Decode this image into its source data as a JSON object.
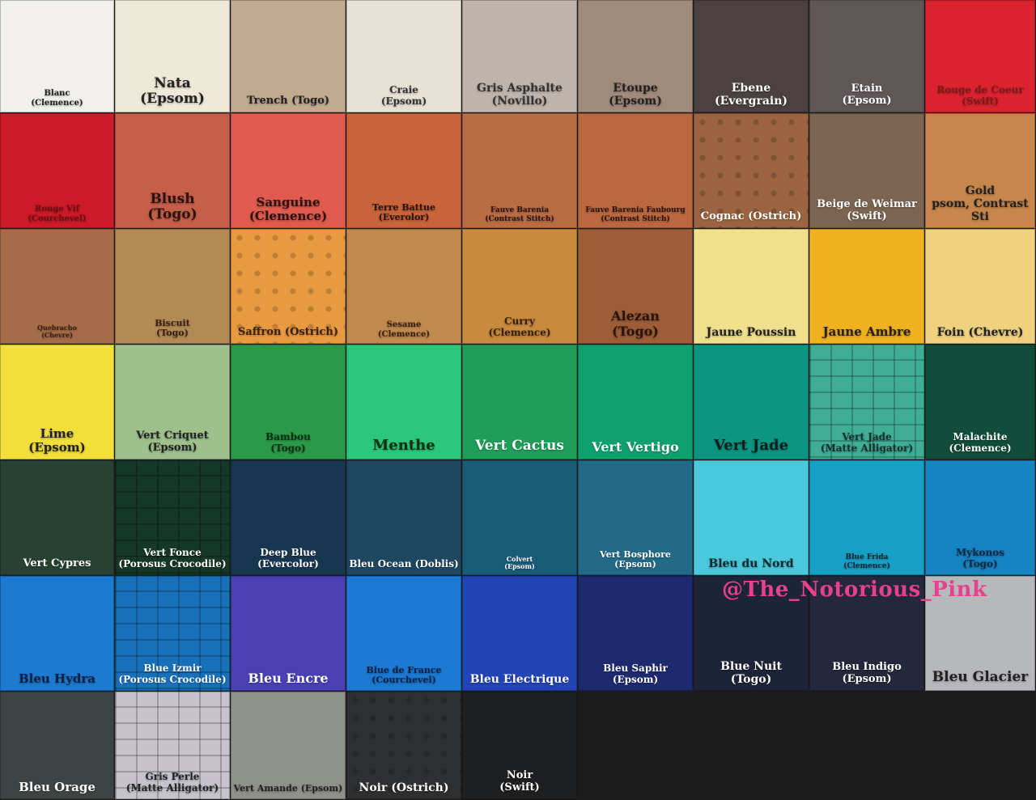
{
  "columns": 9,
  "watermark": "@The_Notorious_Pink",
  "swatches": [
    {
      "label": "Blanc\n(Clemence)",
      "bg": "#f1f0ec",
      "fg": "#222222",
      "size": 10
    },
    {
      "label": "Nata\n(Epsom)",
      "bg": "#efe9d9",
      "fg": "#222222",
      "size": 17
    },
    {
      "label": "Trench (Togo)",
      "bg": "#c1aa90",
      "fg": "#222222",
      "size": 13
    },
    {
      "label": "Craie\n(Epsom)",
      "bg": "#e8e2d6",
      "fg": "#333333",
      "size": 12
    },
    {
      "label": "Gris Asphalte\n(Novillo)",
      "bg": "#bfb5ad",
      "fg": "#333333",
      "size": 14
    },
    {
      "label": "Etoupe\n(Epsom)",
      "bg": "#a08a7c",
      "fg": "#222222",
      "size": 14
    },
    {
      "label": "Ebene\n(Evergrain)",
      "bg": "#4b4140",
      "fg": "#ffffff",
      "size": 14
    },
    {
      "label": "Etain\n(Epsom)",
      "bg": "#5f5757",
      "fg": "#ffffff",
      "size": 13
    },
    {
      "label": "Rouge de Coeur\n(Swift)",
      "bg": "#db2330",
      "fg": "#7a1a1a",
      "size": 12
    },
    {
      "label": "Rouge Vif\n(Courchevel)",
      "bg": "#cc1a2a",
      "fg": "#6a1010",
      "size": 10
    },
    {
      "label": "Blush\n(Togo)",
      "bg": "#c55f49",
      "fg": "#2a1410",
      "size": 17
    },
    {
      "label": "Sanguine\n(Clemence)",
      "bg": "#e05a4e",
      "fg": "#2a1410",
      "size": 15
    },
    {
      "label": "Terre Battue\n(Everolor)",
      "bg": "#c8633a",
      "fg": "#2a1410",
      "size": 11
    },
    {
      "label": "Fauve Barenia\n(Contrast Stitch)",
      "bg": "#b96d44",
      "fg": "#2a1410",
      "size": 9
    },
    {
      "label": "Fauve Barenia Faubourg\n(Contrast Stitch)",
      "bg": "#bb6840",
      "fg": "#2a1410",
      "size": 9
    },
    {
      "label": "Cognac (Ostrich)",
      "bg": "#9c6441",
      "fg": "#ffffff",
      "size": 13,
      "tex": "dots"
    },
    {
      "label": "Beige de Weimar\n(Swift)",
      "bg": "#7b6450",
      "fg": "#ffffff",
      "size": 13
    },
    {
      "label": "Gold\npsom, Contrast Sti",
      "bg": "#c7864b",
      "fg": "#222222",
      "size": 14
    },
    {
      "label": "Quebracho\n(Chevre)",
      "bg": "#a56c4a",
      "fg": "#3a2010",
      "size": 8
    },
    {
      "label": "Biscuit\n(Togo)",
      "bg": "#b38a55",
      "fg": "#3a2010",
      "size": 11
    },
    {
      "label": "Saffron (Ostrich)",
      "bg": "#e89a40",
      "fg": "#3a2010",
      "size": 13,
      "tex": "dots"
    },
    {
      "label": "Sesame\n(Clemence)",
      "bg": "#c08a4e",
      "fg": "#3a2010",
      "size": 10
    },
    {
      "label": "Curry\n(Clemence)",
      "bg": "#c88a3c",
      "fg": "#3a2010",
      "size": 12
    },
    {
      "label": "Alezan\n(Togo)",
      "bg": "#9c5d37",
      "fg": "#2a1410",
      "size": 16
    },
    {
      "label": "Jaune Poussin",
      "bg": "#f1e08b",
      "fg": "#222222",
      "size": 14
    },
    {
      "label": "Jaune Ambre",
      "bg": "#efb21e",
      "fg": "#2a2010",
      "size": 15
    },
    {
      "label": "Foin (Chevre)",
      "bg": "#f0d27e",
      "fg": "#222222",
      "size": 14
    },
    {
      "label": "Lime\n(Epsom)",
      "bg": "#f2df3a",
      "fg": "#222222",
      "size": 15
    },
    {
      "label": "Vert Criquet\n(Epsom)",
      "bg": "#9ec08c",
      "fg": "#222222",
      "size": 13
    },
    {
      "label": "Bambou\n(Togo)",
      "bg": "#2a9a4a",
      "fg": "#103010",
      "size": 12
    },
    {
      "label": "Menthe",
      "bg": "#2bc87c",
      "fg": "#103010",
      "size": 18
    },
    {
      "label": "Vert Cactus",
      "bg": "#1f9e5a",
      "fg": "#ffffff",
      "size": 17
    },
    {
      "label": "Vert Vertigo",
      "bg": "#0fa070",
      "fg": "#ffffff",
      "size": 16
    },
    {
      "label": "Vert Jade",
      "bg": "#0c9580",
      "fg": "#102020",
      "size": 18
    },
    {
      "label": "Vert Jade\n(Matte Alligator)",
      "bg": "#3fae94",
      "fg": "#1a3030",
      "size": 12,
      "tex": "croc"
    },
    {
      "label": "Malachite\n(Clemence)",
      "bg": "#124c3a",
      "fg": "#ffffff",
      "size": 12
    },
    {
      "label": "Vert Cypres",
      "bg": "#274232",
      "fg": "#ffffff",
      "size": 13
    },
    {
      "label": "Vert Fonce\n(Porosus Crocodile)",
      "bg": "#163828",
      "fg": "#ffffff",
      "size": 12,
      "tex": "croc"
    },
    {
      "label": "Deep Blue\n(Evercolor)",
      "bg": "#193650",
      "fg": "#ffffff",
      "size": 12
    },
    {
      "label": "Bleu Ocean (Doblis)",
      "bg": "#1f4860",
      "fg": "#ffffff",
      "size": 12
    },
    {
      "label": "Colvert\n(Epsom)",
      "bg": "#1a5c78",
      "fg": "#ffffff",
      "size": 8
    },
    {
      "label": "Vert Bosphore\n(Epsom)",
      "bg": "#226a88",
      "fg": "#ffffff",
      "size": 11
    },
    {
      "label": "Bleu du Nord",
      "bg": "#4ac8dc",
      "fg": "#102830",
      "size": 14
    },
    {
      "label": "Blue Frida\n(Clemence)",
      "bg": "#16a0c8",
      "fg": "#102830",
      "size": 9
    },
    {
      "label": "Mykonos\n(Togo)",
      "bg": "#1684c2",
      "fg": "#102840",
      "size": 12
    },
    {
      "label": "Bleu Hydra",
      "bg": "#1c7ad0",
      "fg": "#102040",
      "size": 15
    },
    {
      "label": "Blue Izmir\n(Porosus Crocodile)",
      "bg": "#1870b8",
      "fg": "#ffffff",
      "size": 12,
      "tex": "croc"
    },
    {
      "label": "Bleu Encre",
      "bg": "#4a40b4",
      "fg": "#ffffff",
      "size": 16
    },
    {
      "label": "Blue de France\n(Courchevel)",
      "bg": "#1c7ad4",
      "fg": "#102040",
      "size": 11
    },
    {
      "label": "Bleu Electrique",
      "bg": "#2244b4",
      "fg": "#ffffff",
      "size": 14
    },
    {
      "label": "Bleu Saphir\n(Epsom)",
      "bg": "#1d2a6e",
      "fg": "#ffffff",
      "size": 12
    },
    {
      "label": "Blue Nuit\n(Togo)",
      "bg": "#1e2438",
      "fg": "#ffffff",
      "size": 14
    },
    {
      "label": "Bleu Indigo\n(Epsom)",
      "bg": "#25273c",
      "fg": "#ffffff",
      "size": 13
    },
    {
      "label": "Bleu Glacier",
      "bg": "#b6b8bb",
      "fg": "#222222",
      "size": 17
    },
    {
      "label": "Bleu Orage",
      "bg": "#3e4444",
      "fg": "#ffffff",
      "size": 15
    },
    {
      "label": "Gris Perle\n(Matte Alligator)",
      "bg": "#c6c3cc",
      "fg": "#222222",
      "size": 12,
      "tex": "croc"
    },
    {
      "label": "Vert Amande (Epsom)",
      "bg": "#8e9189",
      "fg": "#222222",
      "size": 11
    },
    {
      "label": "Noir (Ostrich)",
      "bg": "#2e2f31",
      "fg": "#ffffff",
      "size": 14,
      "tex": "dots"
    },
    {
      "label": "Noir\n(Swift)",
      "bg": "#1e1f21",
      "fg": "#ffffff",
      "size": 13
    }
  ]
}
